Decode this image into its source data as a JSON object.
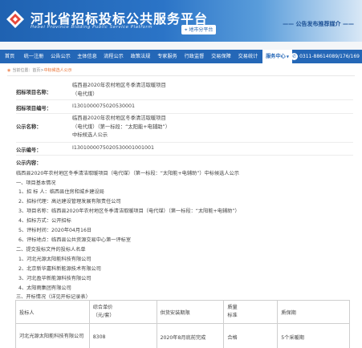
{
  "header": {
    "title": "河北省招标投标公共服务平台",
    "subtitle": "Hebei Province Bidding Public Service Platform",
    "region": "地市分平台",
    "slogan": "—— 公告发布推荐媒介 ——",
    "colors": {
      "band": "#2b74c7",
      "nav": "#2467b7",
      "accent": "#e86b2a"
    }
  },
  "nav": {
    "items": [
      {
        "label": "首页"
      },
      {
        "label": "统一注册"
      },
      {
        "label": "公告公示"
      },
      {
        "label": "主体信息"
      },
      {
        "label": "流程公示"
      },
      {
        "label": "政策法规"
      },
      {
        "label": "专家服务"
      },
      {
        "label": "行政监督"
      },
      {
        "label": "交易保障"
      },
      {
        "label": "交易统计"
      },
      {
        "label": "服务中心"
      }
    ],
    "hotline": "0311-88614089/176/169"
  },
  "breadcrumb": {
    "prefix": "当前位置：",
    "home": "首页",
    "sep1": ">",
    "current": "中标候选人公示"
  },
  "detail": {
    "project_name_label": "招标项目名称：",
    "project_name": "临西县2020年农村地区冬季清洁取暖项目（电代煤）",
    "project_no_label": "招标项目编号：",
    "project_no": "I1301000075020530001",
    "notice_name_label": "公示名称：",
    "notice_name": "临西县2020年农村地区冬季清洁取暖项目（电代煤）（第一标段：“太阳能+电辅助”）中标候选人公示",
    "notice_no_label": "公示编号：",
    "notice_no": "I1301000075020530001001001",
    "content_label": "公示内容："
  },
  "content": {
    "intro": "临西县2020年农村地区冬季清洁取暖项目（电代煤）（第一标段：“太阳能+电辅助”）中标候选人公示",
    "s1": "一、项目基本情况",
    "l1": "1、招 标 人：临西县住房和城乡建设局",
    "l2": "2、招标代理：高达建设管理发展有限责任公司",
    "l3": "3、项目名称：临西县2020年农村地区冬季清洁取暖项目（电代煤）（第一标段：“太阳能+电辅助”）",
    "l4": "4、招标方式：公开招标",
    "l5": "5、评标时间：2020年04月16日",
    "l6": "6、评标地点：临西县公共资源交易中心第一评标室",
    "s2": "二、提交投标文件的投标人名单",
    "b1": "1、河北光源太阳能科技有限公司",
    "b2": "2、北京新华嘉科新能源技术有限公司",
    "b3": "3、河北盈华新能源科技有限公司",
    "b4": "4、太阳雨集团有限公司",
    "s3": "三、开标情况（详见开标记录表）"
  },
  "table": {
    "headers": [
      "投标人",
      "综合单价\n（元/套）",
      "供货安装期限",
      "质量\n标准",
      "质保期"
    ],
    "rows": [
      [
        "河北光源太阳能科技有限公司",
        "8308",
        "2020年8月底前完成",
        "合格",
        "5个采暖期"
      ]
    ]
  }
}
